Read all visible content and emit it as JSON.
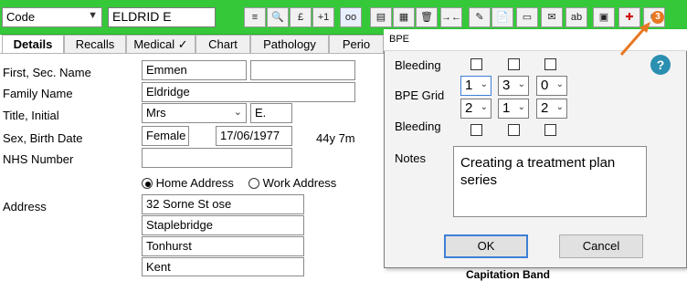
{
  "toolbar": {
    "mode_combo": "Code",
    "patient_name": "ELDRID E",
    "buttons": [
      "≡",
      "🔍",
      "£",
      "+1",
      "oo",
      "▤",
      "▦",
      "🗑",
      "→←",
      "✎",
      "📄",
      "▭",
      "✉",
      "ab",
      "▣",
      "✚",
      "⚙"
    ],
    "badge": "3"
  },
  "tabs": [
    "Details",
    "Recalls",
    "Medical ✓",
    "Chart",
    "Pathology",
    "Perio"
  ],
  "details": {
    "labels": {
      "first_name": "First, Sec. Name",
      "family_name": "Family Name",
      "title_initial": "Title, Initial",
      "sex_dob": "Sex, Birth Date",
      "nhs": "NHS Number",
      "address": "Address"
    },
    "first_name": "Emmen",
    "second_name": "",
    "family_name": "Eldridge",
    "title": "Mrs",
    "initial": "E.",
    "sex": "Female",
    "birth_date": "17/06/1977",
    "age": "44y 7m",
    "nhs_number": "",
    "address_options": {
      "home": "Home Address",
      "work": "Work Address",
      "selected": "home"
    },
    "address_lines": [
      "32 Sorne St   ose",
      "Staplebridge",
      "Tonhurst",
      "Kent"
    ],
    "capitation_partial": "Capitation Band"
  },
  "dialog": {
    "title": "BPE",
    "help": "?",
    "bleeding_label": "Bleeding",
    "bpe_grid_label": "BPE Grid",
    "grid_top": [
      "1",
      "3",
      "0"
    ],
    "grid_bottom": [
      "2",
      "1",
      "2"
    ],
    "notes_label": "Notes",
    "notes_text": "Creating a treatment plan series",
    "ok": "OK",
    "cancel": "Cancel"
  },
  "colors": {
    "toolbar": "#35c93a",
    "annotation_arrow": "#e87722",
    "help": "#2a8fb0"
  }
}
